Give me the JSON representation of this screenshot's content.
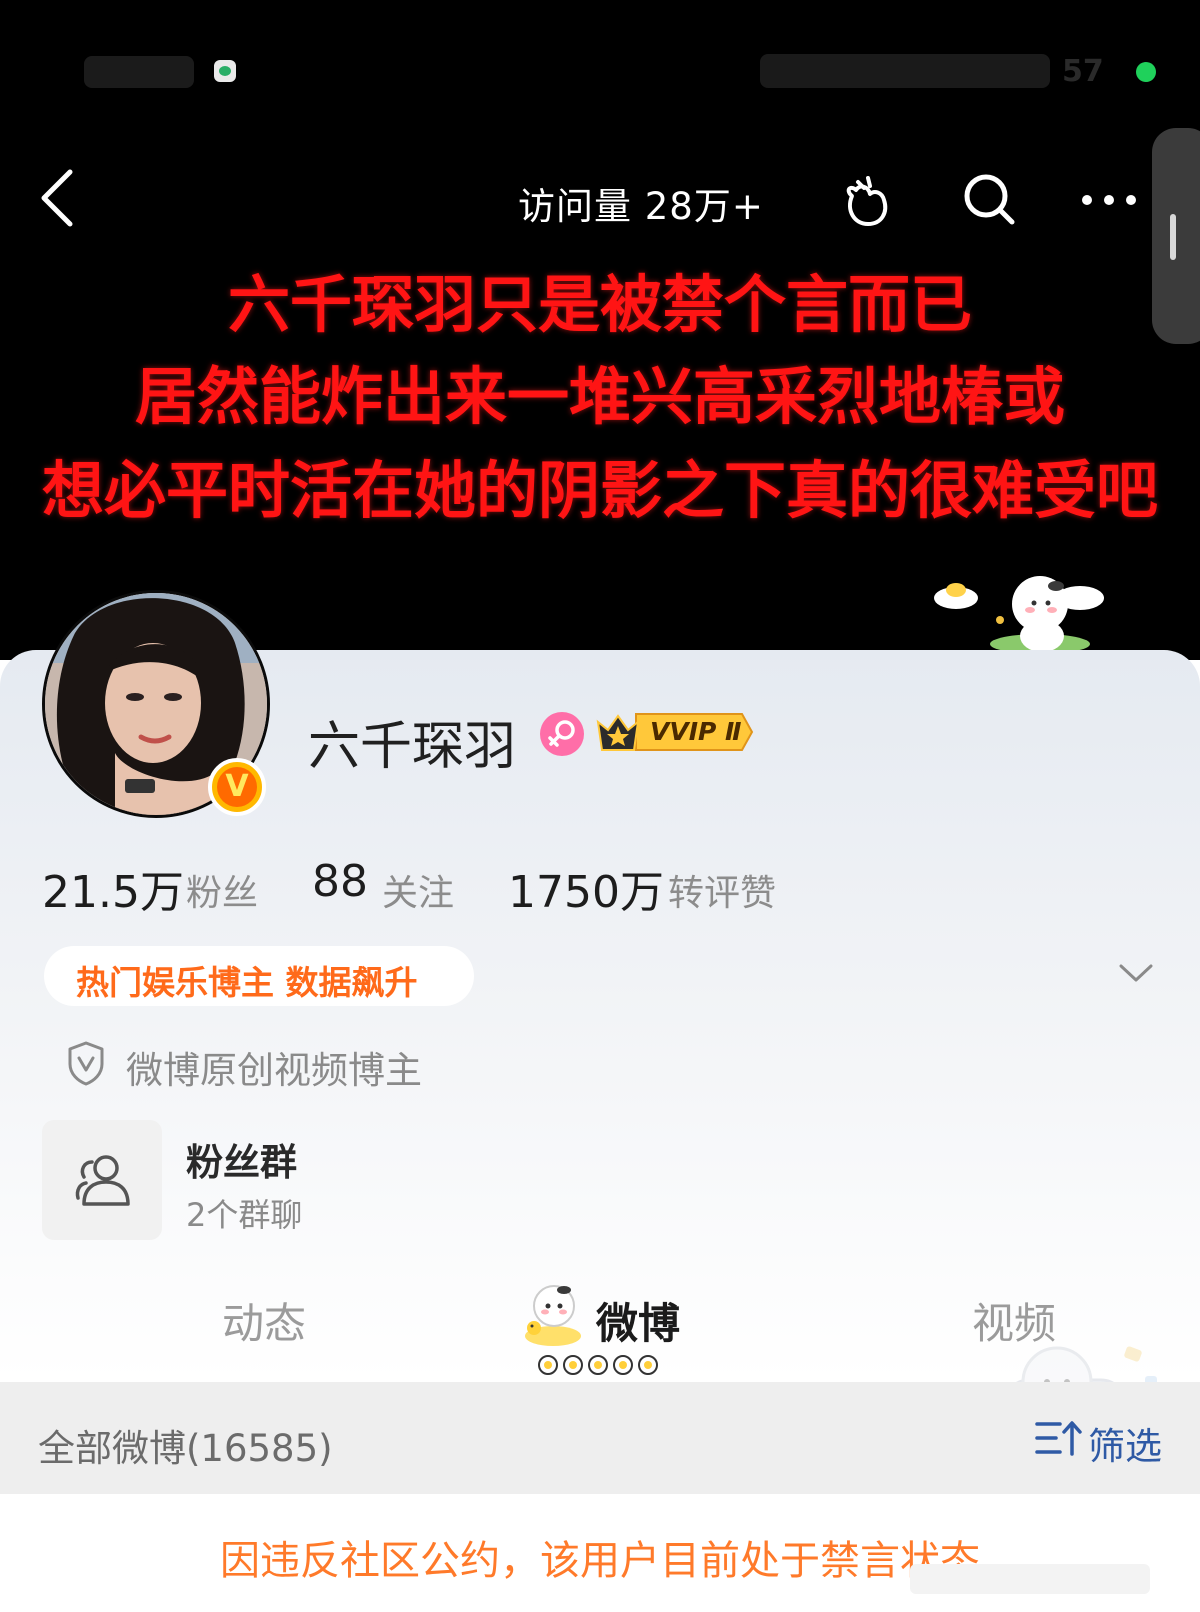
{
  "header": {
    "visit_count": "访问量 28万+",
    "status_time": "57",
    "banner_lines": [
      "六千琛羽只是被禁个言而已",
      "居然能炸出来一堆兴高采烈地椿或",
      "想必平时活在她的阴影之下真的很难受吧"
    ]
  },
  "profile": {
    "username": "六千琛羽",
    "vip_label": "VVIP Ⅱ",
    "verified_glyph": "V",
    "stats": [
      {
        "value": "21.5万",
        "label": "粉丝"
      },
      {
        "value": "88",
        "label": "关注"
      },
      {
        "value": "1750万",
        "label": "转评赞"
      }
    ],
    "hot_tag": "热门娱乐博主 数据飙升",
    "original_video_label": "微博原创视频博主",
    "fan_group": {
      "title": "粉丝群",
      "subtitle": "2个群聊"
    }
  },
  "tabs": [
    {
      "label": "动态",
      "active": false
    },
    {
      "label": "微博",
      "active": true
    },
    {
      "label": "视频",
      "active": false
    }
  ],
  "feed": {
    "all_label": "全部微博(16585)",
    "filter_label": "筛选",
    "ban_notice": "因违反社区公约，该用户目前处于禁言状态"
  },
  "icons": {
    "back": "back-arrow-icon",
    "pet": "pet-sticker-icon",
    "search": "search-icon",
    "more": "more-icon",
    "gender": "female-icon",
    "shield": "shield-icon",
    "fan_group": "group-icon",
    "filter": "filter-icon",
    "expand": "chevron-down-icon"
  },
  "colors": {
    "banner_text": "#ff1414",
    "hot_tag_text": "#ff6a1a",
    "filter_text": "#2f5aa5",
    "ban_notice_text": "#ff7a2a",
    "online_dot": "#1fd15b"
  }
}
